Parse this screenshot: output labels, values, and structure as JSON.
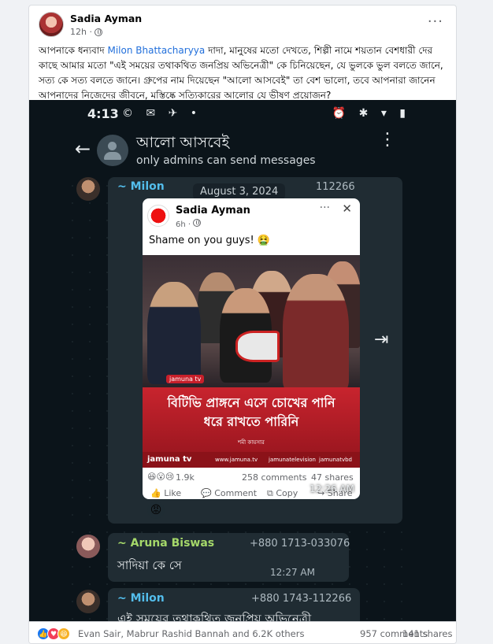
{
  "post": {
    "author": "Sadia Ayman",
    "time": "12h · ",
    "more_label": "···",
    "text_prefix": "আপনাকে ধন্যবাদ ",
    "mention": "Milon Bhattacharyya",
    "text_suffix": " দাদা, মানুষের মতো দেখতে, শিল্পী নামে শয়তান বেশধারী দের কাছে আমার মতো \"এই সময়ের তথাকথিত জনপ্রিয় অভিনেত্রী\" কে চিনিয়েছেন, যে ভুলকে ভুল বলতে জানে, সত্য কে সত্য বলতে জানে। গ্রুপের নাম দিয়েছেন \"আলো আসবেই\" তা বেশ ভালো, তবে আপনারা জানেন আপনাদের নিজেদের জীবনে, মস্তিষ্কে সত্যিকারের আলোর যে ভীষণ প্রয়োজন?"
  },
  "screenshot": {
    "status": {
      "time": "4:13",
      "left_icons": "© ✉ ✈ •",
      "right_icons": "⏰ ✱ ▾ ▮"
    },
    "chat": {
      "back": "←",
      "group_name": "আলো আসবেই",
      "subtitle": "only admins can send messages",
      "menu": "⋮"
    },
    "messages": [
      {
        "sender": "~ Milon",
        "phone": "112266",
        "date_chip": "August 3, 2024",
        "embed": {
          "name": "Sadia Ayman",
          "time": "6h · ",
          "dots": "···",
          "close": "✕",
          "text": "Shame on you guys! 🤮",
          "small_logo": "jamuna tv",
          "headline_1": "বিটিভি প্রাঙ্গনে এসে চোখের পানি",
          "headline_2": "ধরে রাখতে পারিনি",
          "byline": "শমী কায়সার",
          "brand": "jamuna tv",
          "site": "www.jamuna.tv",
          "fb_handle": "jamunatelevision",
          "yt_handle": "jamunatvbd",
          "reaction_icons": "😆😮😢",
          "reactions": "1.9k",
          "comments": "258 comments",
          "shares": "47 shares",
          "like": "👍 Like",
          "comment": "💬 Comment",
          "copy": "⧉ Copy",
          "share": "↪ Share"
        },
        "time": "12:26 AM",
        "forward_icon": "⇥",
        "reaction": "😡"
      },
      {
        "sender": "~ Aruna Biswas",
        "phone": "+880 1713-033076",
        "text": "সাদিয়া কে সে",
        "time": "12:27 AM"
      },
      {
        "sender": "~ Milon",
        "phone": "+880 1743-112266",
        "text": "এই সময়ের তথাকথিত জনপ্রিয় অভিনেত্রী"
      }
    ]
  },
  "footer": {
    "like_icon": "👍",
    "love_icon": "♥",
    "haha_icon": "😆",
    "reactors": "Evan Sair, Mabrur Rashid Bannah and 6.2K others",
    "comments": "957 comments",
    "shares": "141 shares"
  },
  "colors": {
    "mention": "#216fdb",
    "milon_name": "#53bdeb",
    "aruna_name": "#a5d86a",
    "whatsapp_bg": "#0b141a",
    "bubble": "#202c33",
    "news_red": "#c8242e"
  }
}
